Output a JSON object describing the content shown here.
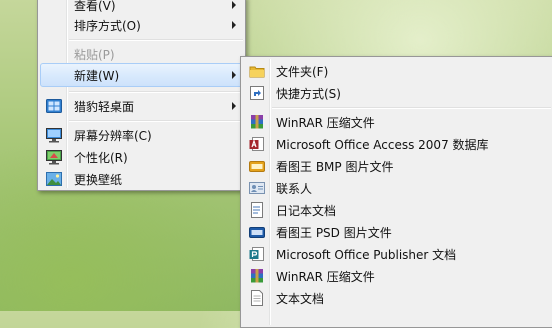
{
  "main_menu": {
    "items": [
      {
        "label": "查看(V)"
      },
      {
        "label": "排序方式(O)"
      },
      {
        "label": "粘贴(P)"
      },
      {
        "label": "新建(W)"
      },
      {
        "label": "猎豹轻桌面"
      },
      {
        "label": "屏幕分辨率(C)"
      },
      {
        "label": "个性化(R)"
      },
      {
        "label": "更换壁纸"
      }
    ]
  },
  "new_submenu": {
    "items": [
      {
        "label": "文件夹(F)",
        "icon": "folder-icon"
      },
      {
        "label": "快捷方式(S)",
        "icon": "shortcut-icon"
      },
      {
        "label": "WinRAR 压缩文件",
        "icon": "winrar-icon"
      },
      {
        "label": "Microsoft Office Access 2007 数据库",
        "icon": "access-icon"
      },
      {
        "label": "看图王 BMP 图片文件",
        "icon": "bmp-icon"
      },
      {
        "label": "联系人",
        "icon": "contact-icon"
      },
      {
        "label": "日记本文档",
        "icon": "journal-icon"
      },
      {
        "label": "看图王 PSD 图片文件",
        "icon": "psd-icon"
      },
      {
        "label": "Microsoft Office Publisher 文档",
        "icon": "publisher-icon"
      },
      {
        "label": "WinRAR 压缩文件",
        "icon": "winrar-zip-icon"
      },
      {
        "label": "文本文档",
        "icon": "text-doc-icon"
      }
    ]
  }
}
